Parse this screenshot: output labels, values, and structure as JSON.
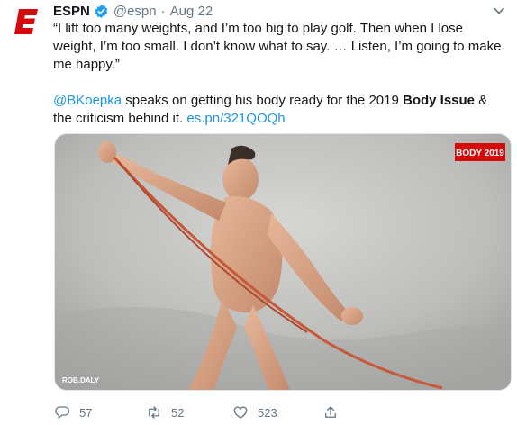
{
  "tweet": {
    "author_name": "ESPN",
    "handle": "@espn",
    "separator": "·",
    "date": "Aug 22",
    "quote": "“I lift too many weights, and I’m too big to play golf. Then when I lose weight, I’m too small. I don’t know what to say. … Listen, I’m going to make me happy.”",
    "mention": "@BKoepka",
    "body_middle": " speaks on getting his body ready for the 2019 ",
    "body_bold": "Body Issue",
    "body_end": " & the criticism behind it. ",
    "link": "es.pn/321QOQh"
  },
  "media": {
    "badge": "BODY 2019",
    "credit": "ROB.DALY"
  },
  "actions": {
    "replies": "57",
    "retweets": "52",
    "likes": "523"
  },
  "colors": {
    "brand": "#d50a0a",
    "verified": "#1da1f2",
    "link": "#1b95e0",
    "muted": "#657786"
  },
  "icons": [
    "espn-logo-icon",
    "verified-icon",
    "chevron-down-icon",
    "reply-icon",
    "retweet-icon",
    "like-icon",
    "share-icon"
  ]
}
